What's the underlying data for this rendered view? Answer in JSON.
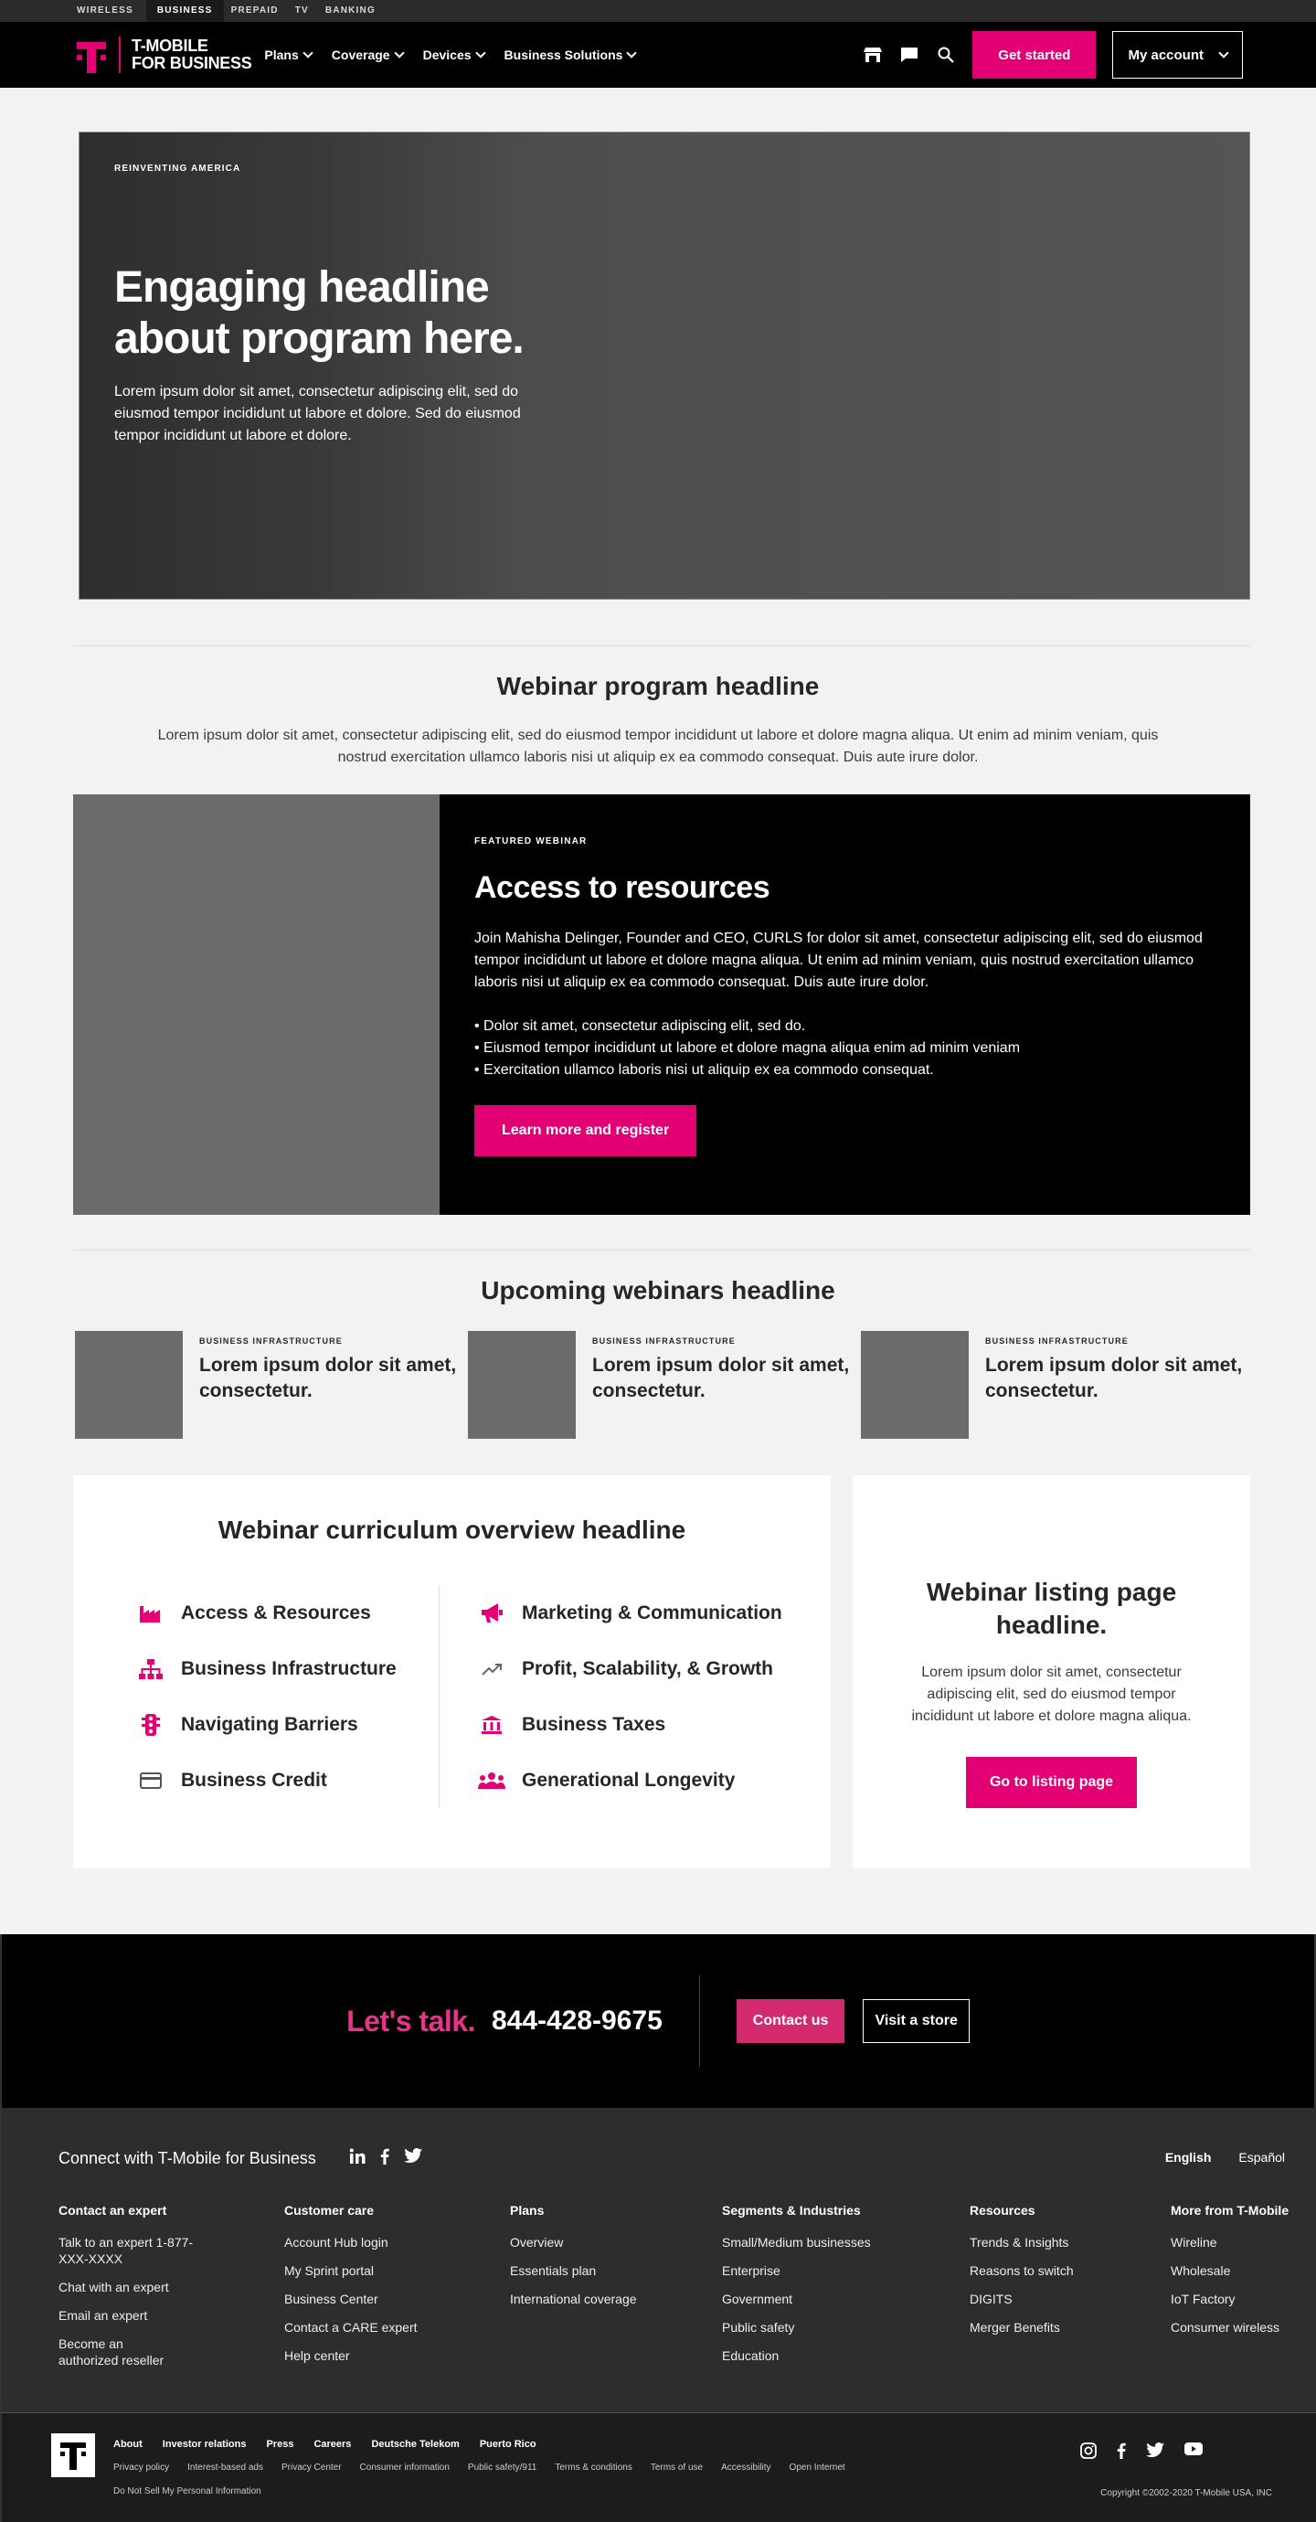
{
  "topstrip": [
    "WIRELESS",
    "BUSINESS",
    "PREPAID",
    "TV",
    "BANKING"
  ],
  "header": {
    "logo_line1": "T-MOBILE",
    "logo_line2": "FOR BUSINESS",
    "nav": [
      "Plans",
      "Coverage",
      "Devices",
      "Business Solutions"
    ],
    "get_started": "Get started",
    "my_account": "My account"
  },
  "hero": {
    "eyebrow": "REINVENTING AMERICA",
    "headline": "Engaging headline about program here.",
    "body": "Lorem ipsum dolor sit amet, consectetur adipiscing elit, sed do eiusmod tempor incididunt ut labore et dolore. Sed do eiusmod tempor incididunt ut labore et dolore."
  },
  "program": {
    "headline": "Webinar program headline",
    "body": "Lorem ipsum dolor sit amet, consectetur adipiscing elit, sed do eiusmod tempor incididunt ut labore et dolore magna aliqua. Ut enim ad minim veniam, quis nostrud exercitation ullamco laboris nisi ut aliquip ex ea commodo consequat. Duis aute irure dolor."
  },
  "featured": {
    "eyebrow": "FEATURED WEBINAR",
    "title": "Access to resources",
    "desc": "Join Mahisha Delinger, Founder and CEO, CURLS for dolor sit amet, consectetur adipiscing elit, sed do eiusmod tempor incididunt ut labore et dolore magna aliqua. Ut enim ad minim veniam, quis nostrud exercitation ullamco laboris nisi ut aliquip ex ea commodo consequat. Duis aute irure dolor.",
    "bullets": [
      "• Dolor sit amet, consectetur adipiscing elit, sed do.",
      "• Eiusmod tempor incididunt ut labore et dolore magna aliqua enim ad minim veniam",
      "• Exercitation ullamco laboris nisi ut aliquip ex ea commodo consequat."
    ],
    "cta": "Learn more and register"
  },
  "upcoming": {
    "headline": "Upcoming webinars headline",
    "cards": [
      {
        "eyebrow": "BUSINESS INFRASTRUCTURE",
        "title": "Lorem ipsum dolor sit amet, consectetur."
      },
      {
        "eyebrow": "BUSINESS INFRASTRUCTURE",
        "title": "Lorem ipsum dolor sit amet, consectetur."
      },
      {
        "eyebrow": "BUSINESS INFRASTRUCTURE",
        "title": "Lorem ipsum dolor sit amet, consectetur."
      }
    ]
  },
  "curriculum": {
    "headline": "Webinar curriculum overview headline",
    "left": [
      {
        "label": "Access & Resources",
        "icon": "factory-icon"
      },
      {
        "label": "Business Infrastructure",
        "icon": "org-chart-icon"
      },
      {
        "label": "Navigating Barriers",
        "icon": "traffic-light-icon"
      },
      {
        "label": "Business Credit",
        "icon": "credit-card-icon"
      }
    ],
    "right": [
      {
        "label": "Marketing & Communication",
        "icon": "megaphone-icon"
      },
      {
        "label": "Profit, Scalability, & Growth",
        "icon": "trending-up-icon"
      },
      {
        "label": "Business Taxes",
        "icon": "bank-icon"
      },
      {
        "label": "Generational Longevity",
        "icon": "group-icon"
      }
    ]
  },
  "listing": {
    "headline": "Webinar listing page headline.",
    "body": "Lorem ipsum dolor sit amet, consectetur adipiscing elit, sed do eiusmod tempor incididunt ut labore et dolore magna aliqua.",
    "cta": "Go to listing page"
  },
  "talk": {
    "lead": "Let's talk.",
    "phone": "844-428-9675",
    "contact": "Contact us",
    "store": "Visit a store"
  },
  "footer": {
    "connect": "Connect with T-Mobile for Business",
    "lang_en": "English",
    "lang_es": "Español",
    "columns": [
      {
        "title": "Contact an expert",
        "items": [
          "Talk to an expert 1-877-XXX-XXXX",
          "Chat with an expert",
          "Email an expert",
          "Become an authorized reseller"
        ]
      },
      {
        "title": "Customer care",
        "items": [
          "Account Hub login",
          "My Sprint portal",
          "Business Center",
          "Contact a CARE expert",
          "Help center"
        ]
      },
      {
        "title": "Plans",
        "items": [
          "Overview",
          "Essentials plan",
          "International coverage"
        ]
      },
      {
        "title": "Segments & Industries",
        "items": [
          "Small/Medium businesses",
          "Enterprise",
          "Government",
          "Public safety",
          "Education"
        ]
      },
      {
        "title": "Resources",
        "items": [
          "Trends & Insights",
          "Reasons to switch",
          "DIGITS",
          "Merger Benefits"
        ]
      },
      {
        "title": "More from T-Mobile",
        "items": [
          "Wireline",
          "Wholesale",
          "IoT Factory",
          "Consumer wireless"
        ]
      }
    ],
    "legal_primary": [
      "About",
      "Investor relations",
      "Press",
      "Careers",
      "Deutsche Telekom",
      "Puerto Rico"
    ],
    "legal_secondary": [
      "Privacy policy",
      "Interest-based ads",
      "Privacy Center",
      "Consumer information",
      "Public safety/911",
      "Terms & conditions",
      "Terms of use",
      "Accessibility",
      "Open Internet"
    ],
    "do_not_sell": "Do Not Sell My Personal Information",
    "copyright": "Copyright ©2002-2020 T-Mobile USA, INC"
  }
}
